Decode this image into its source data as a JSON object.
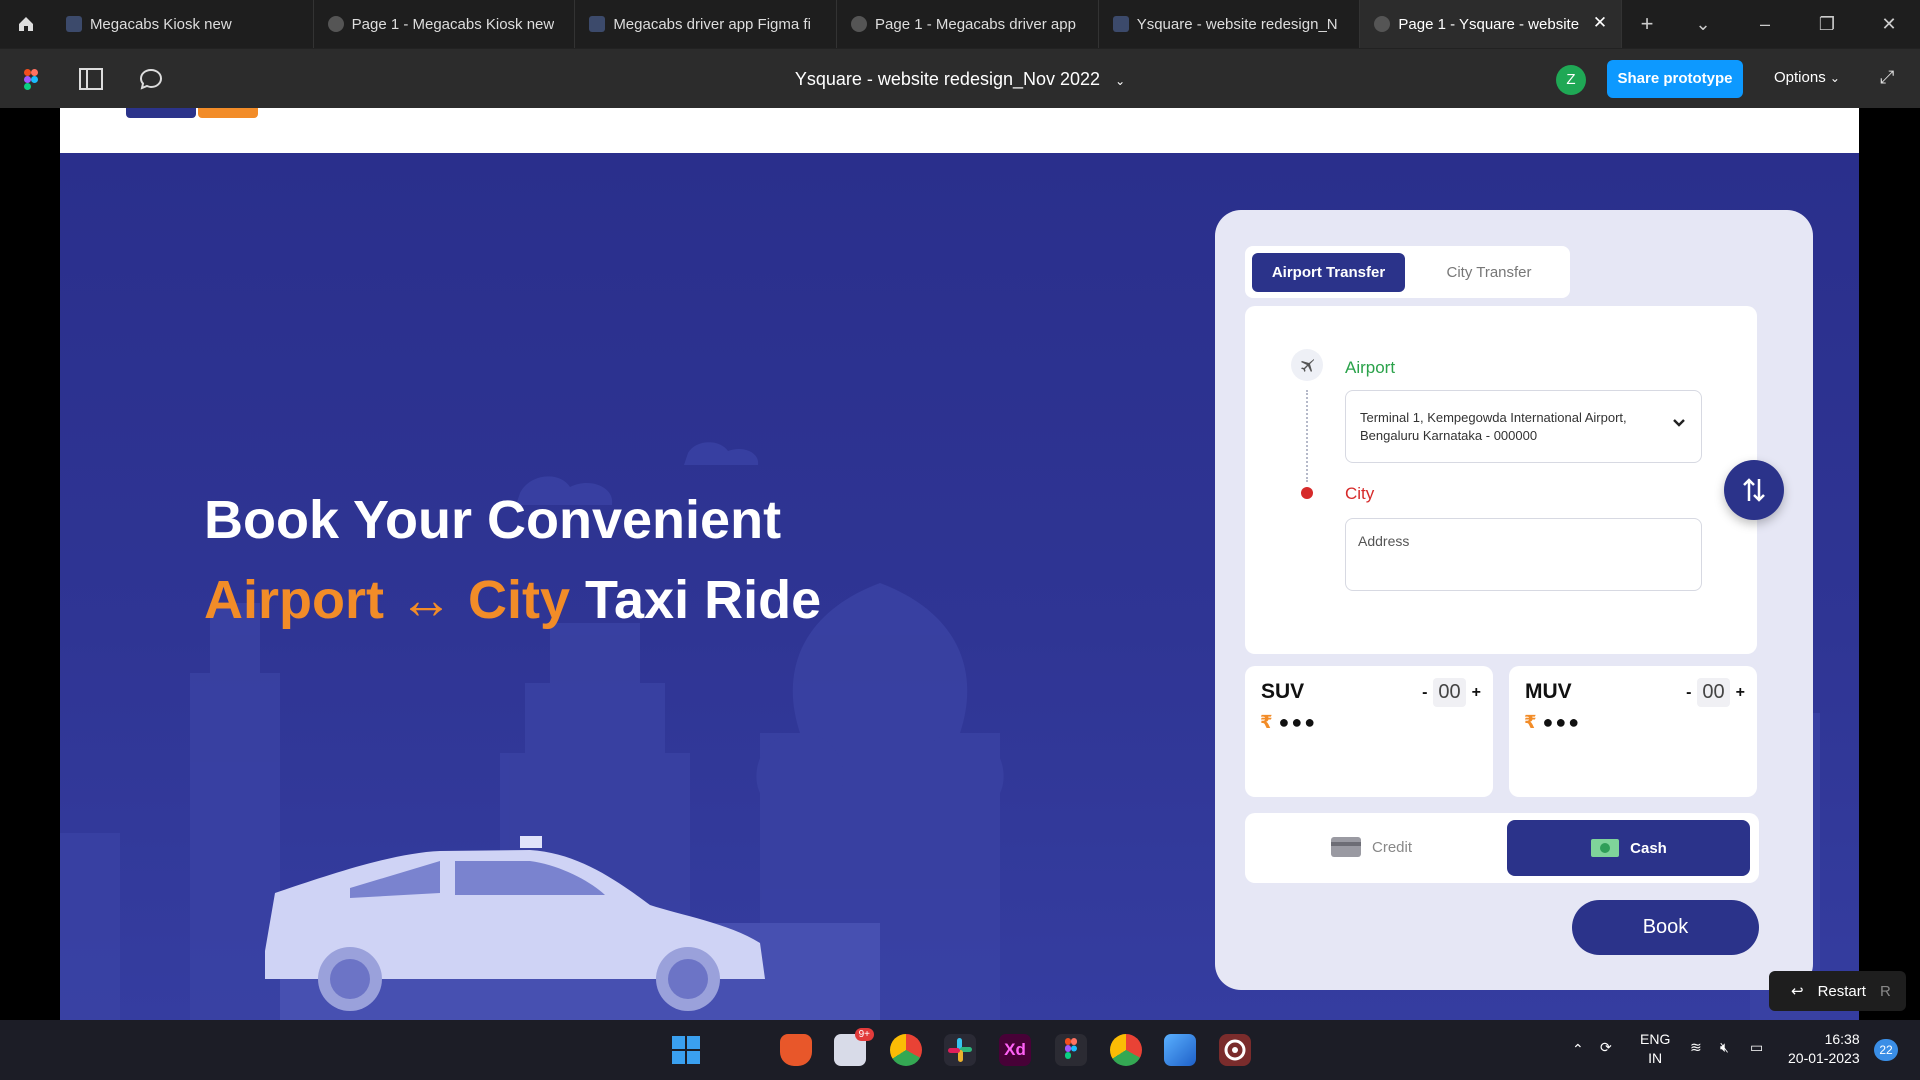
{
  "browser": {
    "tabs": [
      {
        "label": "Megacabs Kiosk new",
        "icon": "figma-file-icon",
        "active": false
      },
      {
        "label": "Page 1 - Megacabs Kiosk new",
        "icon": "prototype-play-icon",
        "active": false
      },
      {
        "label": "Megacabs driver app Figma fi",
        "icon": "figma-file-icon",
        "active": false
      },
      {
        "label": "Page 1 - Megacabs driver app",
        "icon": "prototype-play-icon",
        "active": false
      },
      {
        "label": "Ysquare - website redesign_N",
        "icon": "figma-file-icon",
        "active": false
      },
      {
        "label": "Page 1 - Ysquare - website",
        "icon": "prototype-play-icon",
        "active": true
      }
    ]
  },
  "toolbar": {
    "title": "Ysquare - website redesign_Nov 2022",
    "avatar_initial": "Z",
    "share_label": "Share prototype",
    "options_label": "Options"
  },
  "hero": {
    "line1": "Book Your Convenient",
    "word_airport": "Airport",
    "arrow": "↔",
    "word_city": "City",
    "word_rest": "Taxi Ride"
  },
  "booking": {
    "tab_airport": "Airport Transfer",
    "tab_city": "City Transfer",
    "airport_label": "Airport",
    "airport_value": "Terminal 1, Kempegowda International Airport, Bengaluru Karnataka - 000000",
    "city_label": "City",
    "address_placeholder": "Address",
    "vehicles": [
      {
        "name": "SUV",
        "currency": "₹",
        "price": "●●●",
        "minus": "-",
        "count": "00",
        "plus": "+"
      },
      {
        "name": "MUV",
        "currency": "₹",
        "price": "●●●",
        "minus": "-",
        "count": "00",
        "plus": "+"
      }
    ],
    "payment_credit": "Credit",
    "payment_cash": "Cash",
    "book_label": "Book"
  },
  "restart": {
    "label": "Restart",
    "key": "R"
  },
  "taskbar": {
    "lang": "ENG",
    "region": "IN",
    "time": "16:38",
    "date": "20-01-2023",
    "notifications": "22",
    "mail_badge": "9+"
  },
  "colors": {
    "brand_navy": "#2b338a",
    "accent_orange": "#f28c28",
    "airport_green": "#2aa24a",
    "city_red": "#d62a2a",
    "figma_blue": "#0d99ff"
  }
}
